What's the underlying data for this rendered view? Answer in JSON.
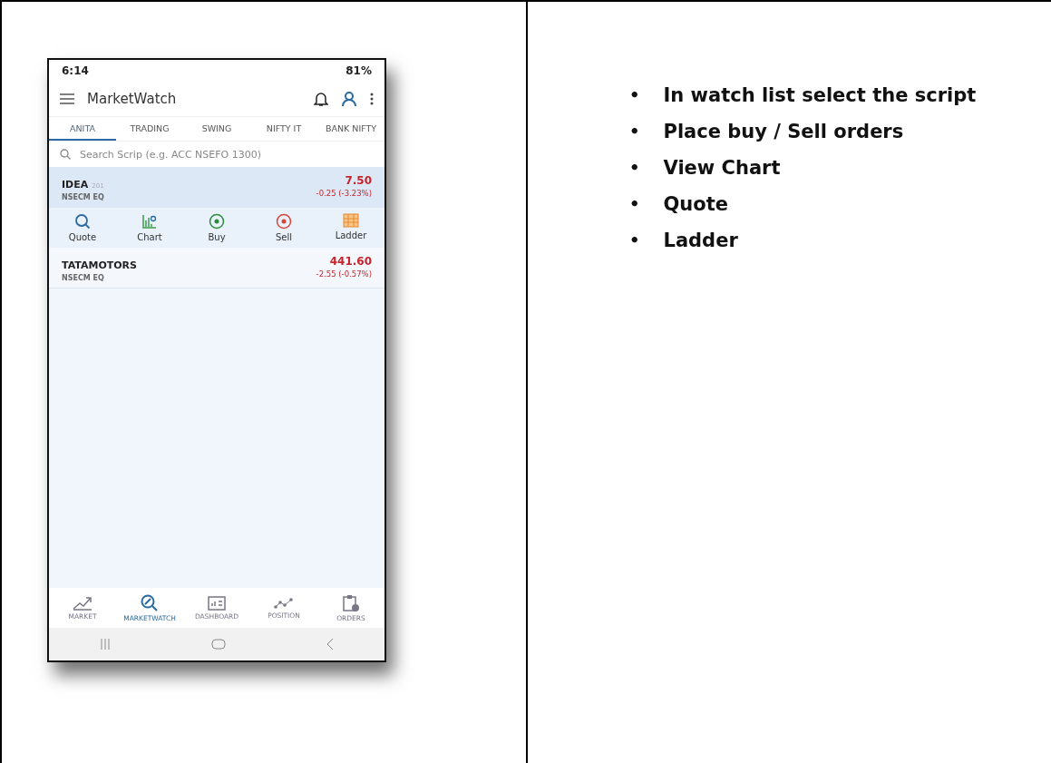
{
  "status_bar": {
    "time": "6:14",
    "battery": "81%"
  },
  "app_bar": {
    "title": "MarketWatch"
  },
  "tabs": [
    {
      "label": "ANITA",
      "selected": true
    },
    {
      "label": "TRADING",
      "selected": false
    },
    {
      "label": "SWING",
      "selected": false
    },
    {
      "label": "NIFTY IT",
      "selected": false
    },
    {
      "label": "BANK NIFTY",
      "selected": false
    }
  ],
  "search": {
    "placeholder": "Search Scrip (e.g. ACC NSEFO 1300)"
  },
  "scrips": [
    {
      "symbol": "IDEA",
      "qty": "201",
      "exchange": "NSECM EQ",
      "price": "7.50",
      "change": "-0.25 (-3.23%)",
      "expanded": true
    },
    {
      "symbol": "TATAMOTORS",
      "exchange": "NSECM EQ",
      "price": "441.60",
      "change": "-2.55 (-0.57%)",
      "expanded": false
    }
  ],
  "actions": [
    {
      "kind": "quote",
      "label": "Quote"
    },
    {
      "kind": "chart",
      "label": "Chart"
    },
    {
      "kind": "buy",
      "label": "Buy"
    },
    {
      "kind": "sell",
      "label": "Sell"
    },
    {
      "kind": "ladder",
      "label": "Ladder"
    }
  ],
  "bottom_nav": [
    {
      "kind": "market",
      "label": "MARKET",
      "selected": false
    },
    {
      "kind": "marketwatch",
      "label": "MARKETWATCH",
      "selected": true
    },
    {
      "kind": "dashboard",
      "label": "DASHBOARD",
      "selected": false
    },
    {
      "kind": "position",
      "label": "POSITION",
      "selected": false
    },
    {
      "kind": "orders",
      "label": "ORDERS",
      "selected": false
    }
  ],
  "notes": [
    {
      "bullet": "•",
      "text": "In watch list select the script"
    },
    {
      "bullet": "•",
      "text": "Place buy / Sell orders"
    },
    {
      "bullet": "•",
      "text": "View Chart"
    },
    {
      "bullet": "•",
      "text": "Quote"
    },
    {
      "bullet": "•",
      "text": "Ladder"
    }
  ]
}
